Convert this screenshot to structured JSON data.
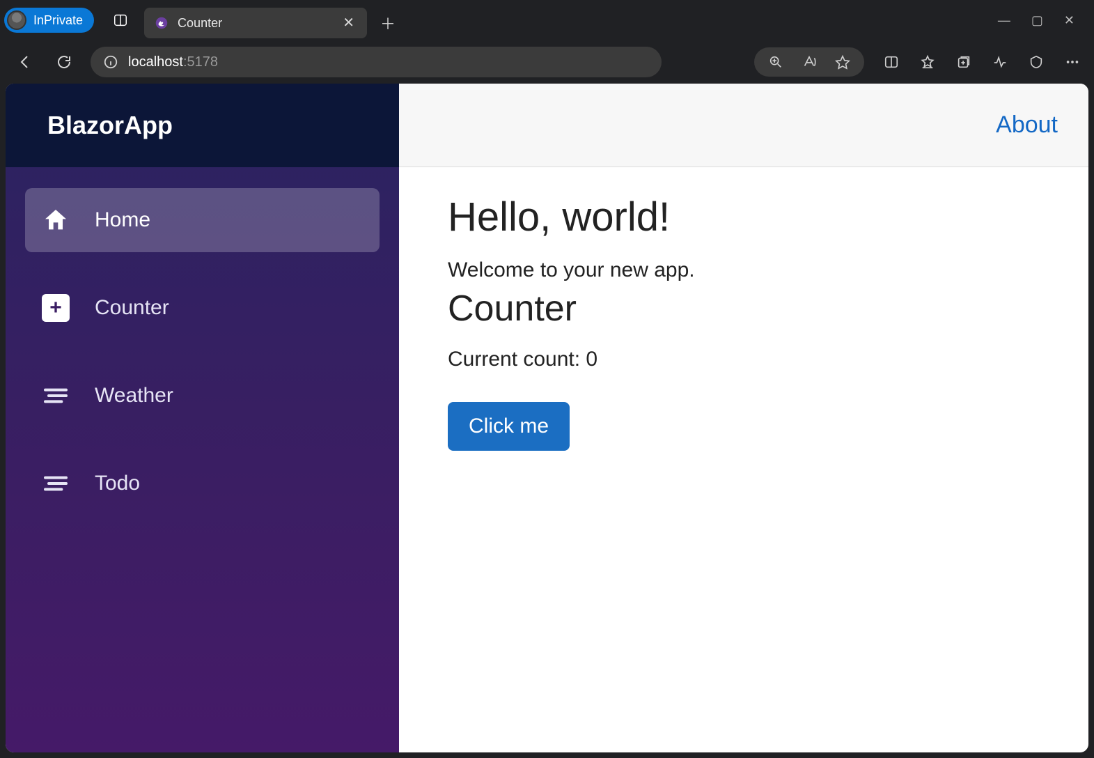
{
  "browser": {
    "inprivate_label": "InPrivate",
    "tab_title": "Counter",
    "url_host": "localhost",
    "url_port": ":5178"
  },
  "sidebar": {
    "brand": "BlazorApp",
    "items": [
      {
        "label": "Home"
      },
      {
        "label": "Counter"
      },
      {
        "label": "Weather"
      },
      {
        "label": "Todo"
      }
    ]
  },
  "header": {
    "about": "About"
  },
  "page": {
    "hello_heading": "Hello, world!",
    "welcome_text": "Welcome to your new app.",
    "counter_heading": "Counter",
    "count_label": "Current count: 0",
    "button_label": "Click me"
  }
}
